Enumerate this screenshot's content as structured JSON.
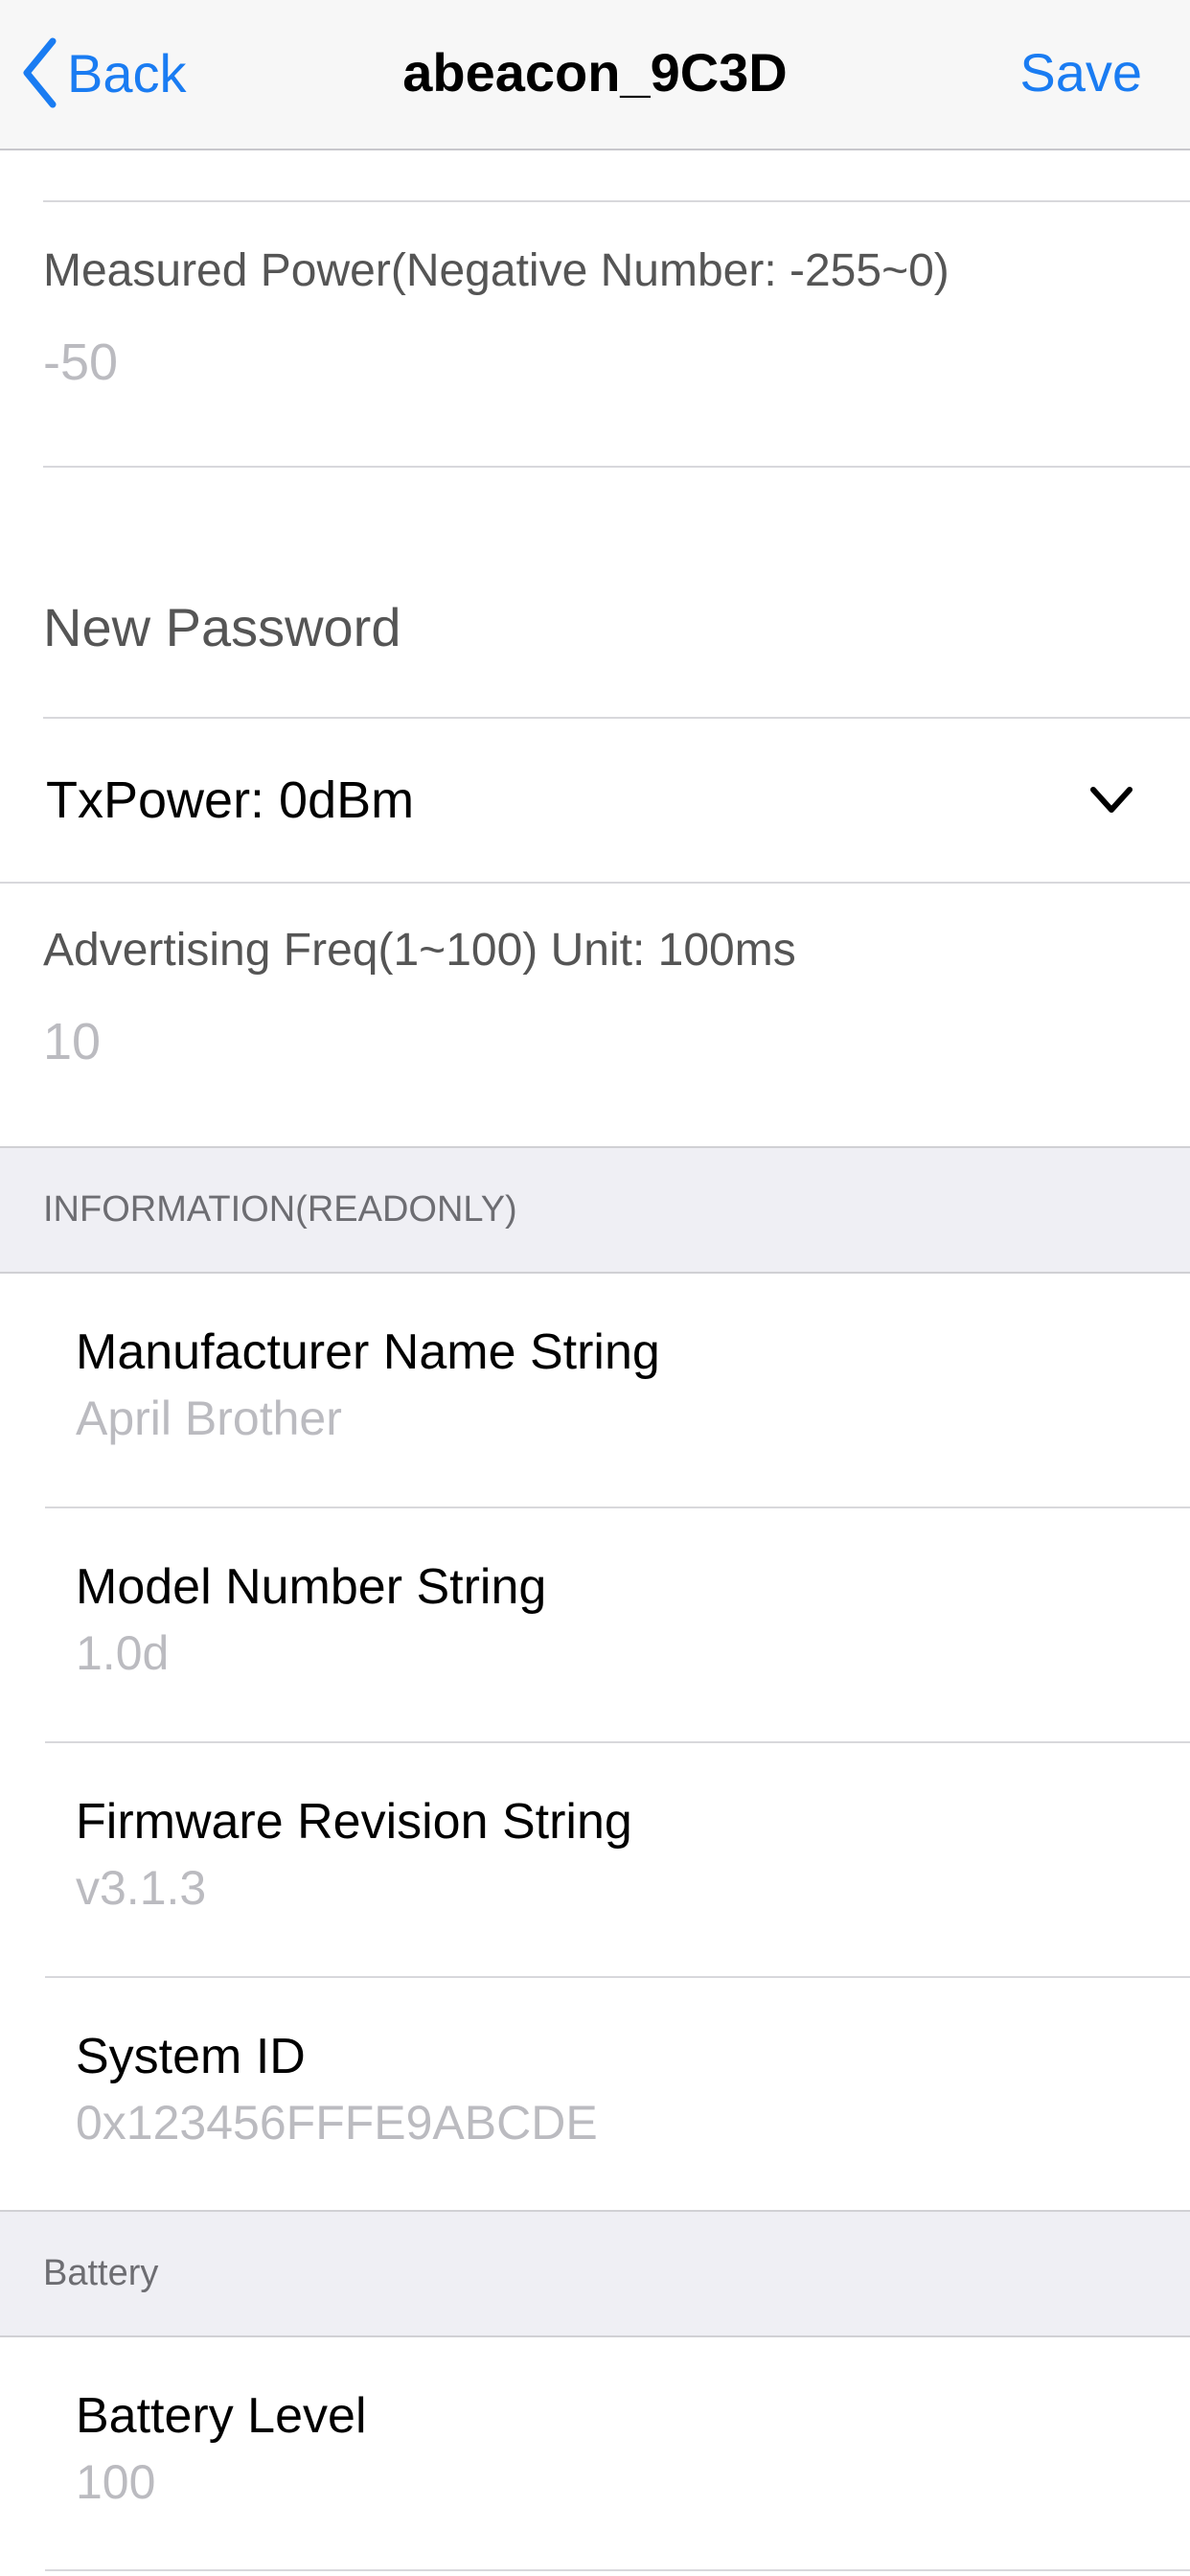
{
  "nav": {
    "back_label": "Back",
    "title": "abeacon_9C3D",
    "save_label": "Save"
  },
  "settings": {
    "measured_power": {
      "label": "Measured Power(Negative Number: -255~0)",
      "placeholder": "-50"
    },
    "new_password": {
      "placeholder": "New Password"
    },
    "tx_power": {
      "label": "TxPower: 0dBm"
    },
    "advertising_freq": {
      "label": "Advertising Freq(1~100) Unit: 100ms",
      "placeholder": "10"
    }
  },
  "information": {
    "header": "INFORMATION(READONLY)",
    "items": [
      {
        "label": "Manufacturer Name String",
        "value": "April Brother"
      },
      {
        "label": "Model Number String",
        "value": "1.0d"
      },
      {
        "label": "Firmware Revision String",
        "value": "v3.1.3"
      },
      {
        "label": "System ID",
        "value": "0x123456FFFE9ABCDE"
      }
    ]
  },
  "battery": {
    "header": "Battery",
    "items": [
      {
        "label": "Battery Level",
        "value": "100"
      }
    ]
  },
  "colors": {
    "accent": "#1a7cf2",
    "placeholder": "#bbbbc0",
    "section_bg": "#efeff4"
  }
}
